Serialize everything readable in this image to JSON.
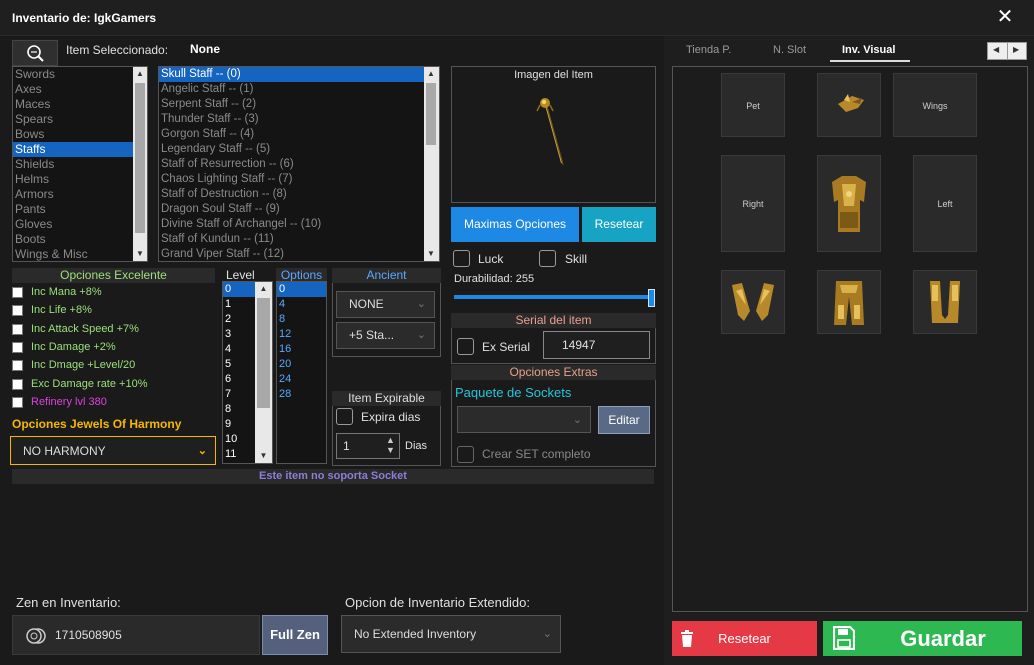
{
  "window": {
    "title": "Inventario de: IgkGamers",
    "close_icon": "close-icon"
  },
  "selected": {
    "label": "Item Seleccionado:",
    "value": "None"
  },
  "categories": {
    "items": [
      "Swords",
      "Axes",
      "Maces",
      "Spears",
      "Bows",
      "Staffs",
      "Shields",
      "Helms",
      "Armors",
      "Pants",
      "Gloves",
      "Boots",
      "Wings & Misc"
    ],
    "selected_index": 5
  },
  "items_list": {
    "items": [
      "Skull Staff  --  (0)",
      "Angelic Staff  --  (1)",
      "Serpent Staff  --  (2)",
      "Thunder Staff  --  (3)",
      "Gorgon Staff  --  (4)",
      "Legendary Staff  --  (5)",
      "Staff of Resurrection  --  (6)",
      "Chaos Lighting Staff  --  (7)",
      "Staff of Destruction  --  (8)",
      "Dragon Soul Staff  --  (9)",
      "Divine Staff of Archangel  --  (10)",
      "Staff of Kundun  --  (11)",
      "Grand Viper Staff  --  (12)"
    ],
    "selected_index": 0
  },
  "image_panel": {
    "title": "Imagen del Item"
  },
  "buttons": {
    "max_options": "Maximas Opciones",
    "reset": "Resetear",
    "edit": "Editar",
    "full_zen": "Full Zen",
    "reset_bottom": "Resetear",
    "save": "Guardar"
  },
  "luck": "Luck",
  "skill": "Skill",
  "durability": {
    "label": "Durabilidad: 255",
    "fraction": 1.0
  },
  "serial": {
    "header": "Serial del item",
    "checkbox": "Ex Serial",
    "value": "14947"
  },
  "extras": {
    "header": "Opciones Extras",
    "sockets_label": "Paquete de Sockets",
    "create_set": "Crear SET completo"
  },
  "excellent": {
    "header": "Opciones Excelente",
    "options": [
      "Inc Mana +8%",
      "Inc Life +8%",
      "Inc Attack Speed +7%",
      "Inc Damage +2%",
      "Inc Dmage +Level/20",
      "Exc Damage rate +10%",
      "Refinery lvl 380"
    ]
  },
  "harmony": {
    "header": "Opciones Jewels Of Harmony",
    "value": "NO HARMONY"
  },
  "level": {
    "header": "Level",
    "items": [
      "0",
      "1",
      "2",
      "3",
      "4",
      "5",
      "6",
      "7",
      "8",
      "9",
      "10",
      "11"
    ],
    "selected_index": 0
  },
  "options": {
    "header": "Options",
    "items": [
      "0",
      "4",
      "8",
      "12",
      "16",
      "20",
      "24",
      "28"
    ],
    "selected_index": 0
  },
  "ancient": {
    "header": "Ancient",
    "value1": "NONE",
    "value2": "+5 Sta..."
  },
  "expirable": {
    "header": "Item Expirable",
    "checkbox": "Expira dias",
    "days_value": "1",
    "days_label": "Dias"
  },
  "socket_note": "Este item no soporta Socket",
  "zen": {
    "label": "Zen en Inventario:",
    "value": "1710508905"
  },
  "extended": {
    "label": "Opcion de Inventario Extendido:",
    "value": "No Extended Inventory"
  },
  "tabs": [
    "Tienda P.",
    "N. Slot",
    "Inv. Visual"
  ],
  "active_tab": 2,
  "slots": {
    "pet": "Pet",
    "wings": "Wings",
    "right": "Right",
    "left": "Left"
  },
  "colors": {
    "accent_blue": "#1e88e5",
    "cyan": "#16a3c4",
    "red": "#e53945",
    "green": "#2eb852",
    "green_text": "#9be07a",
    "magenta": "#e040e0",
    "gold": "#f5b800",
    "purple_note": "#8a7fd8"
  }
}
